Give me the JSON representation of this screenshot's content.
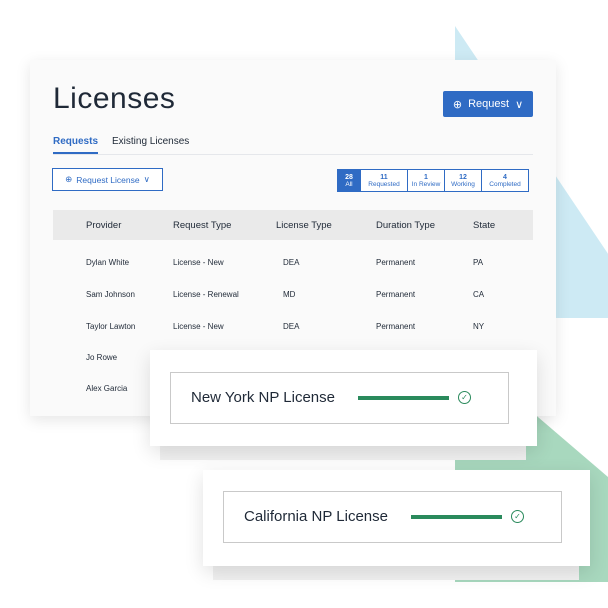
{
  "page": {
    "title": "Licenses",
    "request_button": "Request"
  },
  "tabs": [
    {
      "label": "Requests",
      "active": true
    },
    {
      "label": "Existing Licenses",
      "active": false
    }
  ],
  "request_license_button": "Request License",
  "filters": [
    {
      "count": "28",
      "label": "All",
      "active": true
    },
    {
      "count": "11",
      "label": "Requested",
      "active": false
    },
    {
      "count": "1",
      "label": "In Review",
      "active": false
    },
    {
      "count": "12",
      "label": "Working",
      "active": false
    },
    {
      "count": "4",
      "label": "Completed",
      "active": false
    }
  ],
  "table": {
    "columns": [
      "Provider",
      "Request Type",
      "License Type",
      "Duration Type",
      "State"
    ],
    "rows": [
      [
        "Dylan White",
        "License - New",
        "DEA",
        "Permanent",
        "PA"
      ],
      [
        "Sam Johnson",
        "License - Renewal",
        "MD",
        "Permanent",
        "CA"
      ],
      [
        "Taylor Lawton",
        "License - New",
        "DEA",
        "Permanent",
        "NY"
      ],
      [
        "Jo Rowe",
        "",
        "",
        "",
        ""
      ],
      [
        "Alex Garcia",
        "",
        "",
        "",
        ""
      ]
    ]
  },
  "cards": [
    {
      "label": "New York NP License",
      "complete": true
    },
    {
      "label": "California NP License",
      "complete": true
    }
  ],
  "colors": {
    "accent": "#2f6bc4",
    "success": "#2a8a5c",
    "deco_blue": "#cfeaf3",
    "deco_green": "#a8d8be"
  }
}
